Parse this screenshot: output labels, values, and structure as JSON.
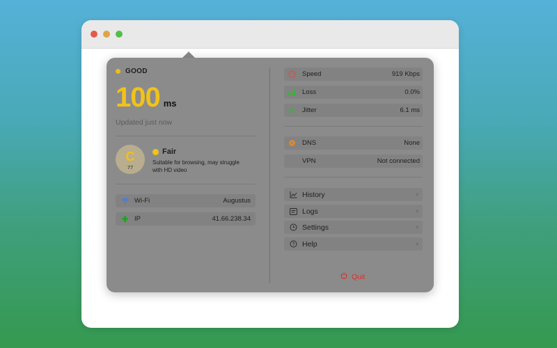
{
  "status": {
    "label": "GOOD",
    "color": "#e9bd1a"
  },
  "latency": {
    "value": "100",
    "unit": "ms",
    "updated": "Updated just now",
    "color": "#f1c21b"
  },
  "grade": {
    "letter": "C",
    "score": "77",
    "title": "Fair",
    "description": "Suitable for browsing, may struggle with HD video"
  },
  "connection": {
    "wifi": {
      "label": "Wi-Fi",
      "value": "Augustus",
      "icon": "wifi-icon"
    },
    "ip": {
      "label": "IP",
      "value": "41.66.238.34",
      "icon": "globe-icon"
    }
  },
  "metrics": [
    {
      "label": "Speed",
      "value": "919 Kbps",
      "icon": "speedometer-icon",
      "color": "#d94f4f"
    },
    {
      "label": "Loss",
      "value": "0.0%",
      "icon": "bars-icon",
      "color": "#3fae3f"
    },
    {
      "label": "Jitter",
      "value": "6.1 ms",
      "icon": "waveform-icon",
      "color": "#3fae3f"
    }
  ],
  "network": [
    {
      "label": "DNS",
      "value": "None",
      "icon": "dns-icon",
      "color": "#e0862f"
    },
    {
      "label": "VPN",
      "value": "Not connected",
      "icon": "vpn-icon"
    }
  ],
  "menu": [
    {
      "label": "History",
      "icon": "chart-icon"
    },
    {
      "label": "Logs",
      "icon": "list-icon"
    },
    {
      "label": "Settings",
      "icon": "gear-icon"
    },
    {
      "label": "Help",
      "icon": "question-icon"
    }
  ],
  "quit": {
    "label": "Quit",
    "icon": "power-icon",
    "color": "#d9302a"
  }
}
